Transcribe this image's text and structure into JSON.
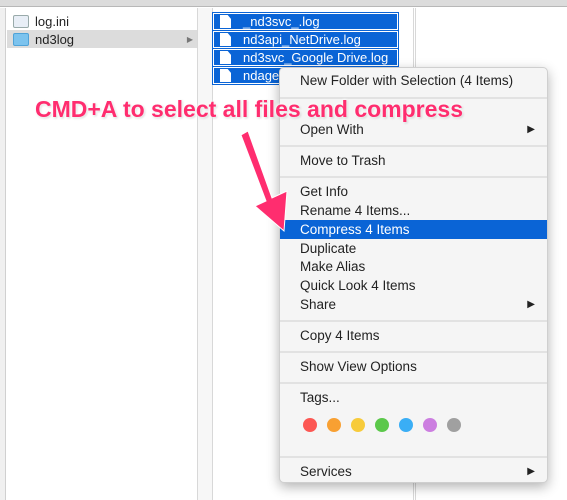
{
  "sidebar": {
    "items": [
      {
        "label": "log.ini",
        "icon": "ini-file-icon"
      },
      {
        "label": "nd3log",
        "icon": "folder-icon",
        "selected": true
      }
    ]
  },
  "files": [
    "_nd3svc_.log",
    "nd3api_NetDrive.log",
    "nd3svc_Google Drive.log",
    "ndagent.log"
  ],
  "menu": {
    "new_folder": "New Folder with Selection (4 Items)",
    "open_with": "Open With",
    "move_to_trash": "Move to Trash",
    "get_info": "Get Info",
    "rename": "Rename 4 Items...",
    "compress": "Compress 4 Items",
    "duplicate": "Duplicate",
    "make_alias": "Make Alias",
    "quick_look": "Quick Look 4 Items",
    "share": "Share",
    "copy": "Copy 4 Items",
    "show_view_options": "Show View Options",
    "tags": "Tags...",
    "services": "Services",
    "tag_colors": [
      "#fc5753",
      "#f8a032",
      "#f7cb3b",
      "#5bc84a",
      "#3aaef5",
      "#cc7ee0",
      "#a0a0a0"
    ]
  },
  "annotation": {
    "text": "CMD+A to select all files and compress",
    "color": "#ff2d6f"
  }
}
